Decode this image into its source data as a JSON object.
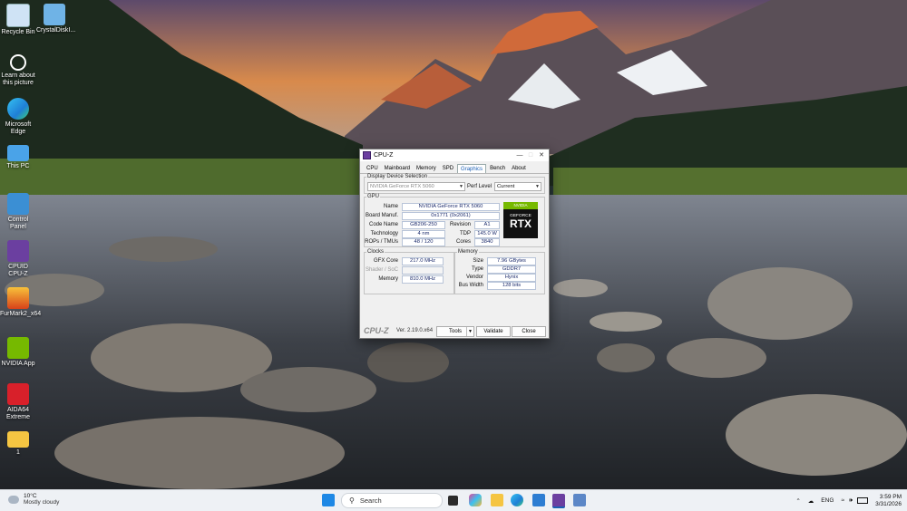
{
  "desktop": {
    "icons": [
      {
        "label": "Recycle Bin"
      },
      {
        "label": "CrystalDiskI..."
      },
      {
        "label": "Learn about this picture"
      },
      {
        "label": "Microsoft Edge"
      },
      {
        "label": "This PC"
      },
      {
        "label": "Control Panel"
      },
      {
        "label": "CPUID CPU-Z"
      },
      {
        "label": "FurMark2_x64"
      },
      {
        "label": "NVIDIA App"
      },
      {
        "label": "AIDA64 Extreme"
      },
      {
        "label": "1"
      }
    ]
  },
  "window": {
    "title": "CPU-Z",
    "tabs": [
      "CPU",
      "Mainboard",
      "Memory",
      "SPD",
      "Graphics",
      "Bench",
      "About"
    ],
    "active_tab": "Graphics",
    "display_device": {
      "legend": "Display Device Selection",
      "selected": "NVIDIA GeForce RTX 5060",
      "perf_level_label": "Perf Level",
      "perf_level_value": "Current"
    },
    "gpu": {
      "legend": "GPU",
      "name_label": "Name",
      "name": "NVIDIA GeForce RTX 5060",
      "board_label": "Board Manuf.",
      "board": "0x1771 (0x2061)",
      "code_name_label": "Code Name",
      "code_name": "GB206-250",
      "revision_label": "Revision",
      "revision": "A1",
      "technology_label": "Technology",
      "technology": "4 nm",
      "tdp_label": "TDP",
      "tdp": "145.0 W",
      "rops_label": "ROPs / TMUs",
      "rops": "48 / 120",
      "cores_label": "Cores",
      "cores": "3840",
      "badge": {
        "brand": "NVIDIA",
        "line1": "GEFORCE",
        "line2": "RTX"
      }
    },
    "clocks": {
      "legend": "Clocks",
      "gfx_label": "GFX Core",
      "gfx": "217.0 MHz",
      "shader_label": "Shader / SoC",
      "shader": "",
      "memory_label": "Memory",
      "memory": "810.0 MHz"
    },
    "memory": {
      "legend": "Memory",
      "size_label": "Size",
      "size": "7.96 GBytes",
      "type_label": "Type",
      "type": "GDDR7",
      "vendor_label": "Vendor",
      "vendor": "Hynix",
      "bus_label": "Bus Width",
      "bus": "128 bits"
    },
    "footer": {
      "logo": "CPU-Z",
      "version": "Ver. 2.19.0.x64",
      "tools": "Tools",
      "validate": "Validate",
      "close": "Close"
    }
  },
  "taskbar": {
    "weather_temp": "10°C",
    "weather_desc": "Mostly cloudy",
    "search_placeholder": "Search",
    "lang": "ENG",
    "time": "3:59 PM",
    "date": "3/31/2026"
  },
  "colors": {
    "accent": "#1a5fb4",
    "nvidia_green": "#76b900",
    "cpuz_purple": "#6b3fa0"
  }
}
